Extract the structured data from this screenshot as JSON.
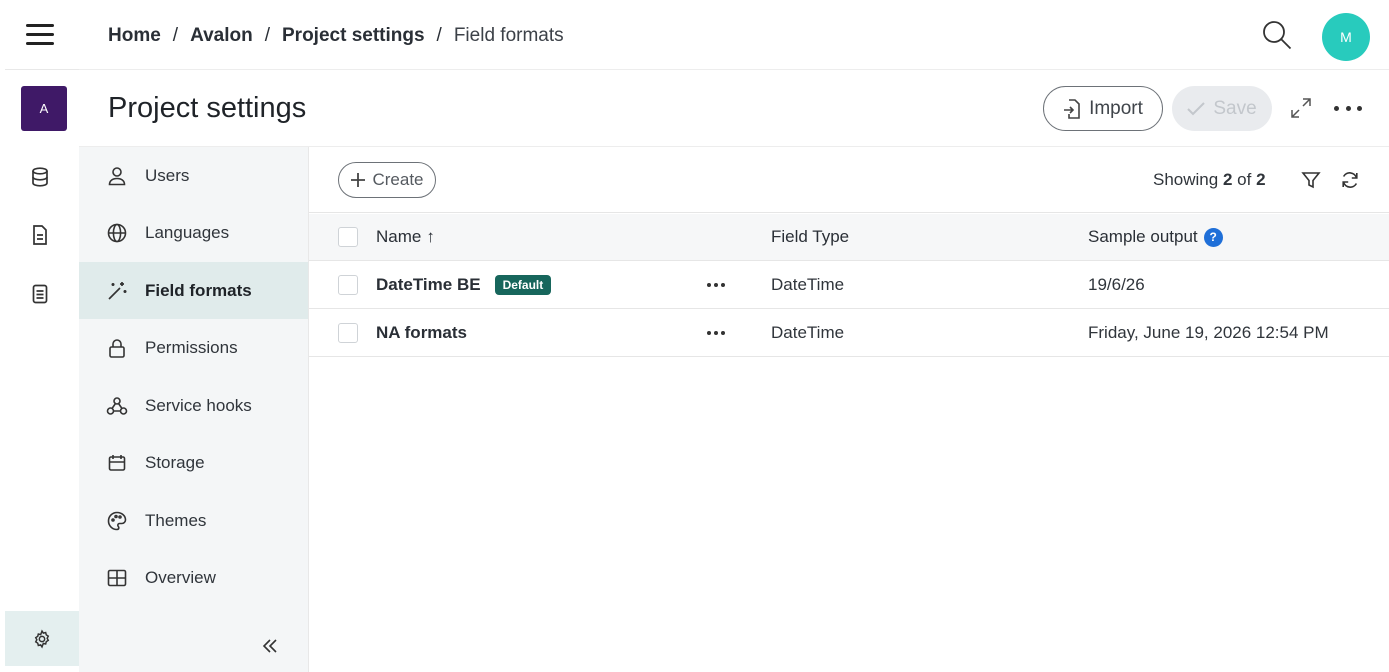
{
  "rail": {
    "project_initial": "A",
    "icons": [
      "database-icon",
      "document-icon",
      "list-icon"
    ],
    "settings_icon": "gear-icon"
  },
  "topbar": {
    "breadcrumbs": [
      {
        "label": "Home"
      },
      {
        "label": "Avalon"
      },
      {
        "label": "Project settings"
      }
    ],
    "separator": "/",
    "current": "Field formats",
    "avatar_initial": "M",
    "avatar_color": "#28cbbd"
  },
  "page": {
    "title": "Project settings",
    "import_label": "Import",
    "save_label": "Save"
  },
  "sidenav": {
    "items": [
      {
        "label": "Users",
        "icon": "user-icon"
      },
      {
        "label": "Languages",
        "icon": "globe-icon"
      },
      {
        "label": "Field formats",
        "icon": "magic-wand-icon",
        "active": true
      },
      {
        "label": "Permissions",
        "icon": "lock-icon"
      },
      {
        "label": "Service hooks",
        "icon": "webhook-icon"
      },
      {
        "label": "Storage",
        "icon": "storage-icon"
      },
      {
        "label": "Themes",
        "icon": "palette-icon"
      },
      {
        "label": "Overview",
        "icon": "grid-icon"
      }
    ],
    "collapse_icon": "double-chevron-left-icon"
  },
  "main": {
    "create_label": "Create",
    "showing": {
      "prefix": "Showing",
      "count": "2",
      "of": "of",
      "total": "2"
    },
    "table": {
      "columns": {
        "name": "Name",
        "sort_arrow": "↑",
        "type": "Field Type",
        "sample": "Sample output",
        "help": "?"
      },
      "rows": [
        {
          "name": "DateTime BE",
          "badge": "Default",
          "type": "DateTime",
          "sample": "19/6/26"
        },
        {
          "name": "NA formats",
          "badge": "",
          "type": "DateTime",
          "sample": "Friday, June 19, 2026 12:54 PM"
        }
      ]
    }
  },
  "colors": {
    "project_badge": "#3f1967",
    "default_badge": "#17665c",
    "active_nav": "#e0ebeb",
    "help_icon": "#1f6fd8"
  }
}
